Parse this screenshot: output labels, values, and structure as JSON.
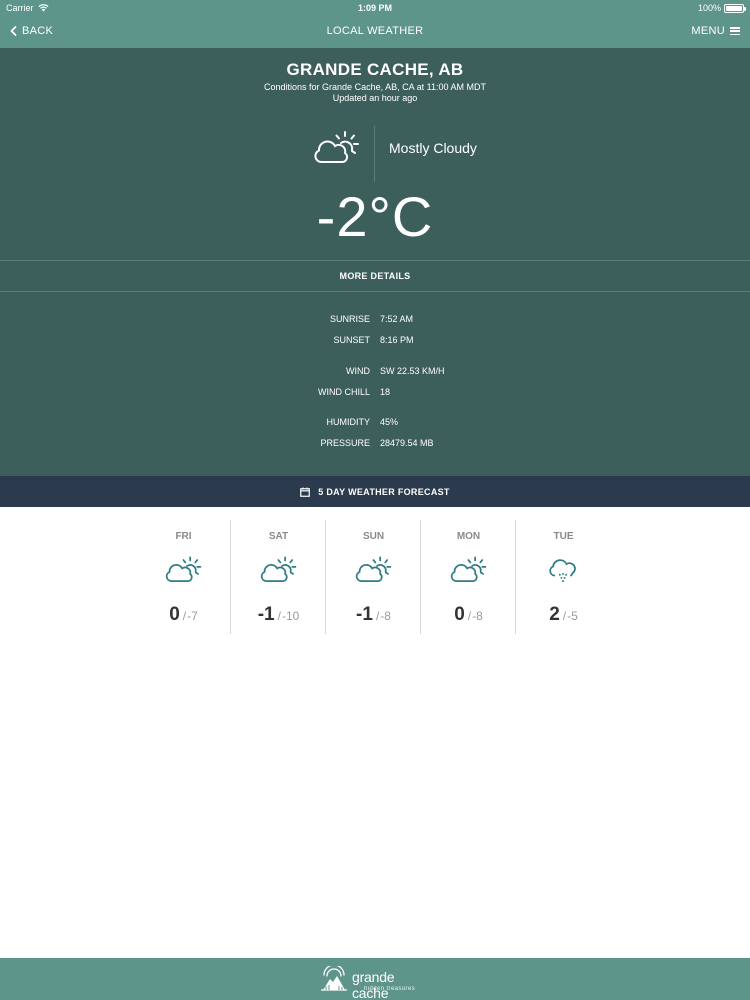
{
  "status_bar": {
    "carrier": "Carrier",
    "time": "1:09 PM",
    "battery": "100%"
  },
  "nav": {
    "back_label": "BACK",
    "title": "LOCAL WEATHER",
    "menu_label": "MENU"
  },
  "current": {
    "location": "GRANDE CACHE, AB",
    "conditions_line": "Conditions for Grande Cache, AB, CA at 11:00 AM MDT",
    "updated_line": "Updated an hour ago",
    "condition_icon": "partly-cloudy-icon",
    "condition_text": "Mostly Cloudy",
    "temperature": "-2°C",
    "more_details_label": "MORE DETAILS"
  },
  "details": [
    {
      "label": "SUNRISE",
      "value": "7:52 AM"
    },
    {
      "label": "SUNSET",
      "value": "8:16 PM"
    },
    {
      "label": "WIND",
      "value": "SW 22.53 KM/H"
    },
    {
      "label": "WIND CHILL",
      "value": "18"
    },
    {
      "label": "HUMIDITY",
      "value": "45%"
    },
    {
      "label": "PRESSURE",
      "value": "28479.54 MB"
    }
  ],
  "forecast": {
    "header": "5 DAY WEATHER FORECAST",
    "slash": "/",
    "days": [
      {
        "name": "FRI",
        "icon": "partly-cloudy-icon",
        "high": "0",
        "low": "-7"
      },
      {
        "name": "SAT",
        "icon": "partly-cloudy-icon",
        "high": "-1",
        "low": "-10"
      },
      {
        "name": "SUN",
        "icon": "partly-cloudy-icon",
        "high": "-1",
        "low": "-8"
      },
      {
        "name": "MON",
        "icon": "partly-cloudy-icon",
        "high": "0",
        "low": "-8"
      },
      {
        "name": "TUE",
        "icon": "snow-cloud-icon",
        "high": "2",
        "low": "-5"
      }
    ]
  },
  "footer": {
    "logo_name": "grande cache",
    "logo_tagline": "hidden treasures"
  },
  "colors": {
    "nav_bg": "#5e958a",
    "current_bg": "#3d5f5c",
    "forecast_header_bg": "#2c3a4d",
    "icon_teal": "#2f7c84"
  }
}
